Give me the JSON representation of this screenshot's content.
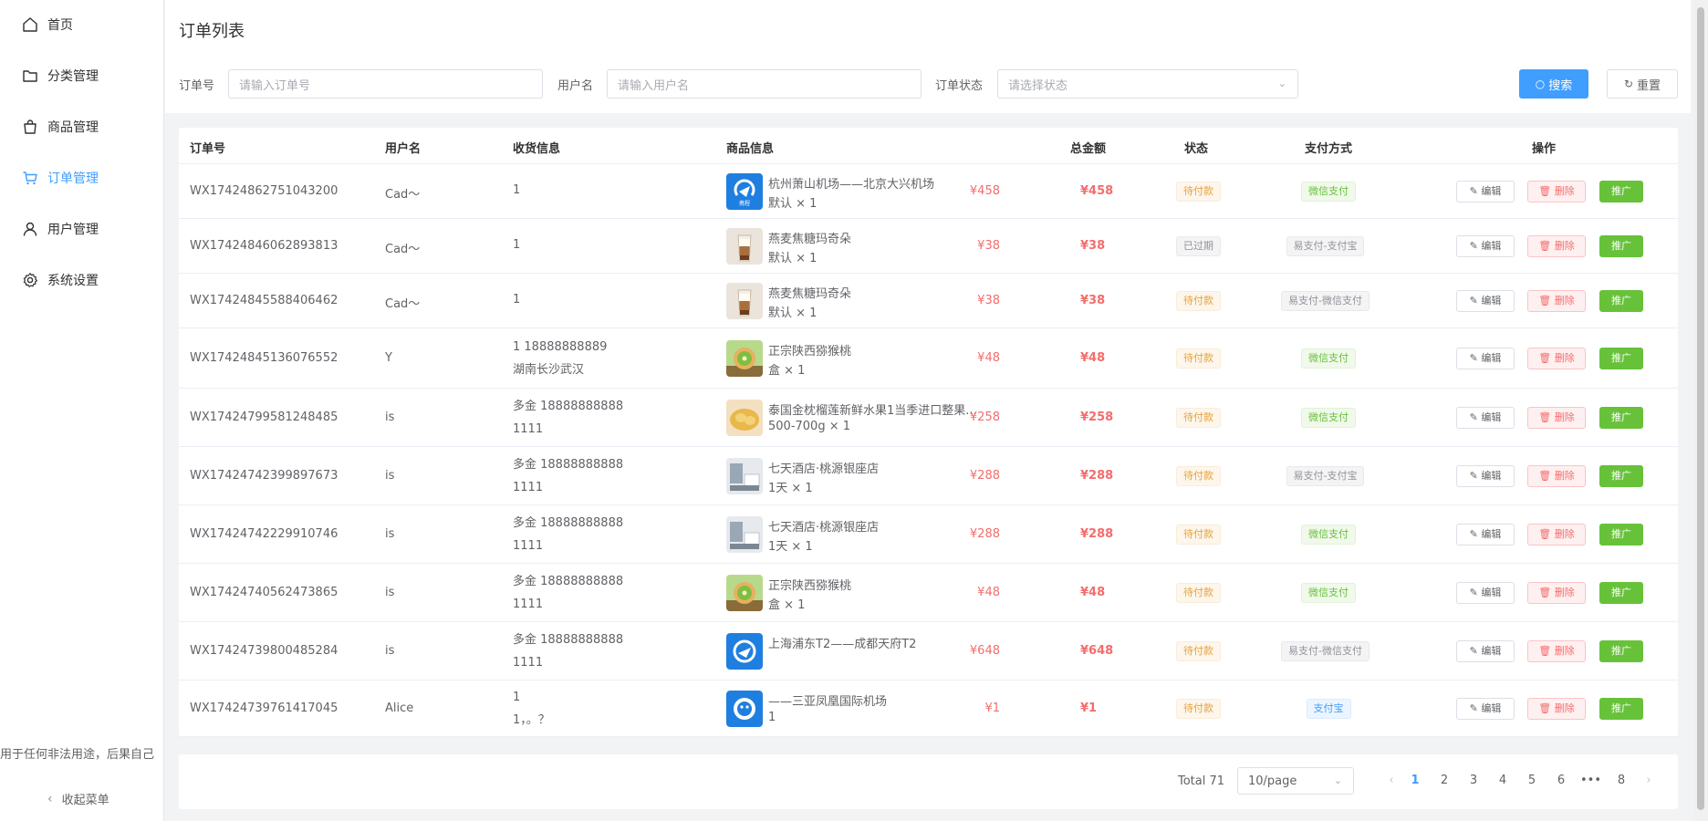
{
  "sidebar": {
    "items": [
      {
        "label": "首页",
        "icon": "home-icon"
      },
      {
        "label": "分类管理",
        "icon": "folder-icon"
      },
      {
        "label": "商品管理",
        "icon": "shopping-bag-icon"
      },
      {
        "label": "订单管理",
        "icon": "cart-icon",
        "active": true
      },
      {
        "label": "用户管理",
        "icon": "user-icon"
      },
      {
        "label": "系统设置",
        "icon": "gear-icon"
      }
    ],
    "footer_text": "用于任何非法用途，后果自己",
    "collapse_label": "收起菜单"
  },
  "page": {
    "title": "订单列表"
  },
  "search": {
    "order_no_label": "订单号",
    "order_no_placeholder": "请输入订单号",
    "username_label": "用户名",
    "username_placeholder": "请输入用户名",
    "status_label": "订单状态",
    "status_placeholder": "请选择状态",
    "search_label": "搜索",
    "reset_label": "重置"
  },
  "table": {
    "headers": {
      "order_no": "订单号",
      "username": "用户名",
      "shipping": "收货信息",
      "product": "商品信息",
      "total": "总金额",
      "status": "状态",
      "payment": "支付方式",
      "actions": "操作"
    },
    "action_labels": {
      "edit": "编辑",
      "delete": "删除",
      "promote": "推广"
    },
    "rows": [
      {
        "order_no": "WX17424862751043200",
        "username": "Cad～",
        "ship1": "1",
        "ship2": "",
        "thumb": "airport",
        "name": "杭州萧山机场——北京大兴机场",
        "spec": "默认 × 1",
        "price": "¥458",
        "total": "¥458",
        "status": "待付款",
        "status_type": "warn",
        "pay": "微信支付",
        "pay_type": "success"
      },
      {
        "order_no": "WX17424846062893813",
        "username": "Cad～",
        "ship1": "1",
        "ship2": "",
        "thumb": "coffee",
        "name": "燕麦焦糖玛奇朵",
        "spec": "默认 × 1",
        "price": "¥38",
        "total": "¥38",
        "status": "已过期",
        "status_type": "info",
        "pay": "易支付-支付宝",
        "pay_type": "info"
      },
      {
        "order_no": "WX17424845588406462",
        "username": "Cad～",
        "ship1": "1",
        "ship2": "",
        "thumb": "coffee",
        "name": "燕麦焦糖玛奇朵",
        "spec": "默认 × 1",
        "price": "¥38",
        "total": "¥38",
        "status": "待付款",
        "status_type": "warn",
        "pay": "易支付-微信支付",
        "pay_type": "info"
      },
      {
        "order_no": "WX17424845136076552",
        "username": "Y",
        "ship1": "1 18888888889",
        "ship2": "湖南长沙武汉",
        "thumb": "kiwi",
        "name": "正宗陕西猕猴桃",
        "spec": "盒 × 1",
        "price": "¥48",
        "total": "¥48",
        "status": "待付款",
        "status_type": "warn",
        "pay": "微信支付",
        "pay_type": "success"
      },
      {
        "order_no": "WX17424799581248485",
        "username": "is",
        "ship1": "多金 18888888888",
        "ship2": "1111",
        "thumb": "durian",
        "name": "泰国金枕榴莲新鲜水果1当季进口整果...",
        "spec": "500-700g × 1",
        "price": "¥258",
        "total": "¥258",
        "status": "待付款",
        "status_type": "warn",
        "pay": "微信支付",
        "pay_type": "success"
      },
      {
        "order_no": "WX17424742399897673",
        "username": "is",
        "ship1": "多金 18888888888",
        "ship2": "1111",
        "thumb": "hotel",
        "name": "七天酒店·桃源银座店",
        "spec": "1天 × 1",
        "price": "¥288",
        "total": "¥288",
        "status": "待付款",
        "status_type": "warn",
        "pay": "易支付-支付宝",
        "pay_type": "info"
      },
      {
        "order_no": "WX17424742229910746",
        "username": "is",
        "ship1": "多金 18888888888",
        "ship2": "1111",
        "thumb": "hotel",
        "name": "七天酒店·桃源银座店",
        "spec": "1天 × 1",
        "price": "¥288",
        "total": "¥288",
        "status": "待付款",
        "status_type": "warn",
        "pay": "微信支付",
        "pay_type": "success"
      },
      {
        "order_no": "WX17424740562473865",
        "username": "is",
        "ship1": "多金 18888888888",
        "ship2": "1111",
        "thumb": "kiwi",
        "name": "正宗陕西猕猴桃",
        "spec": "盒 × 1",
        "price": "¥48",
        "total": "¥48",
        "status": "待付款",
        "status_type": "warn",
        "pay": "微信支付",
        "pay_type": "success"
      },
      {
        "order_no": "WX17424739800485284",
        "username": "is",
        "ship1": "多金 18888888888",
        "ship2": "1111",
        "thumb": "flight",
        "name": "上海浦东T2——成都天府T2",
        "spec": "",
        "price": "¥648",
        "total": "¥648",
        "status": "待付款",
        "status_type": "warn",
        "pay": "易支付-微信支付",
        "pay_type": "info"
      },
      {
        "order_no": "WX17424739761417045",
        "username": "Alice",
        "ship1": "1",
        "ship2": "1，。？",
        "thumb": "flight2",
        "name": "——三亚凤凰国际机场",
        "spec": "1",
        "price": "¥1",
        "total": "¥1",
        "status": "待付款",
        "status_type": "warn",
        "pay": "支付宝",
        "pay_type": "primary"
      }
    ]
  },
  "pagination": {
    "total_text": "Total 71",
    "page_size": "10/page",
    "pages": [
      "1",
      "2",
      "3",
      "4",
      "5",
      "6",
      "•••",
      "8"
    ],
    "current": "1"
  },
  "colors": {
    "primary": "#409eff",
    "danger": "#f56c6c",
    "success": "#67c23a",
    "warning": "#e6a23c"
  }
}
